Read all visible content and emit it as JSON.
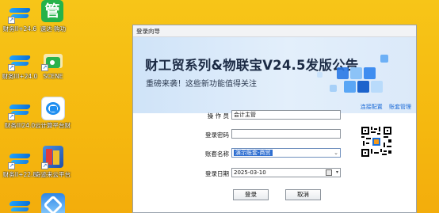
{
  "desktop": {
    "icons": [
      {
        "caption": "财务II+24.6",
        "kind": "ie"
      },
      {
        "caption": "速达·购功",
        "kind": "guan"
      },
      {
        "caption": "财务III+24.0",
        "kind": "ie"
      },
      {
        "caption": "SCENE",
        "kind": "scene"
      },
      {
        "caption": "财务III24.0",
        "kind": "ie"
      },
      {
        "caption": "云计算平台财工贸",
        "kind": "cloud"
      },
      {
        "caption": "财务II+22.8",
        "kind": "ie"
      },
      {
        "caption": "奇迹来云平台工工贸",
        "kind": "rain"
      },
      {
        "caption": "",
        "kind": "ie"
      },
      {
        "caption": "",
        "kind": "sky"
      }
    ],
    "guan_char": "管",
    "shortcut_arrow": "↗"
  },
  "dialog": {
    "title": "登录向导",
    "banner": {
      "title": "财工贸系列&物联宝V24.5发版公告",
      "subtitle": "重磅来袭！这些新功能值得关注"
    },
    "links": {
      "connect": "连接配置",
      "accounts": "账套管理"
    },
    "form": {
      "operator_label": "操 作 员",
      "operator_value": "会计主管",
      "password_label": "登录密码",
      "password_value": "",
      "account_label": "账套名称",
      "account_value": "演示账套-商贸",
      "date_label": "登录日期",
      "date_value": "2025-03-10"
    },
    "buttons": {
      "login": "登录",
      "cancel": "取消"
    },
    "icons": {
      "dropdown": "chevron-down-icon",
      "calendar": "calendar-icon",
      "qr": "qr-code-icon"
    }
  },
  "colors": {
    "desktop_bg": "#f5b80f",
    "banner_bg": "#dbe9f9",
    "link": "#1b6ad6",
    "selection": "#2f6fd1"
  }
}
